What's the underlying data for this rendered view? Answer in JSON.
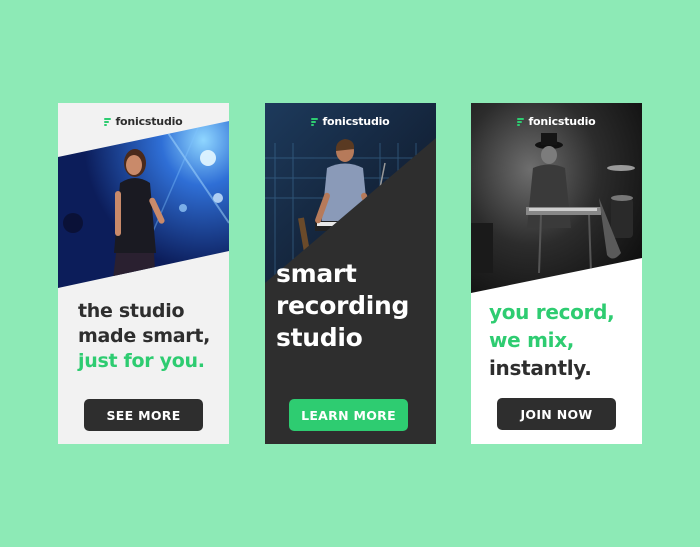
{
  "colors": {
    "background": "#8deab6",
    "accent_green": "#2ecc71",
    "dark": "#2e2e2e",
    "light": "#f2f2f2"
  },
  "brand": {
    "name": "fonicstudio"
  },
  "banners": [
    {
      "headline": [
        "the studio",
        "made smart,",
        "just for you."
      ],
      "cta_label": "SEE MORE",
      "photo_icon": "singer-on-stage-photo"
    },
    {
      "headline": [
        "smart",
        "recording",
        "studio"
      ],
      "cta_label": "LEARN MORE",
      "photo_icon": "keyboard-player-photo"
    },
    {
      "headline": [
        "you record,",
        "we mix,",
        "instantly."
      ],
      "cta_label": "JOIN NOW",
      "photo_icon": "band-stage-bw-photo"
    }
  ]
}
